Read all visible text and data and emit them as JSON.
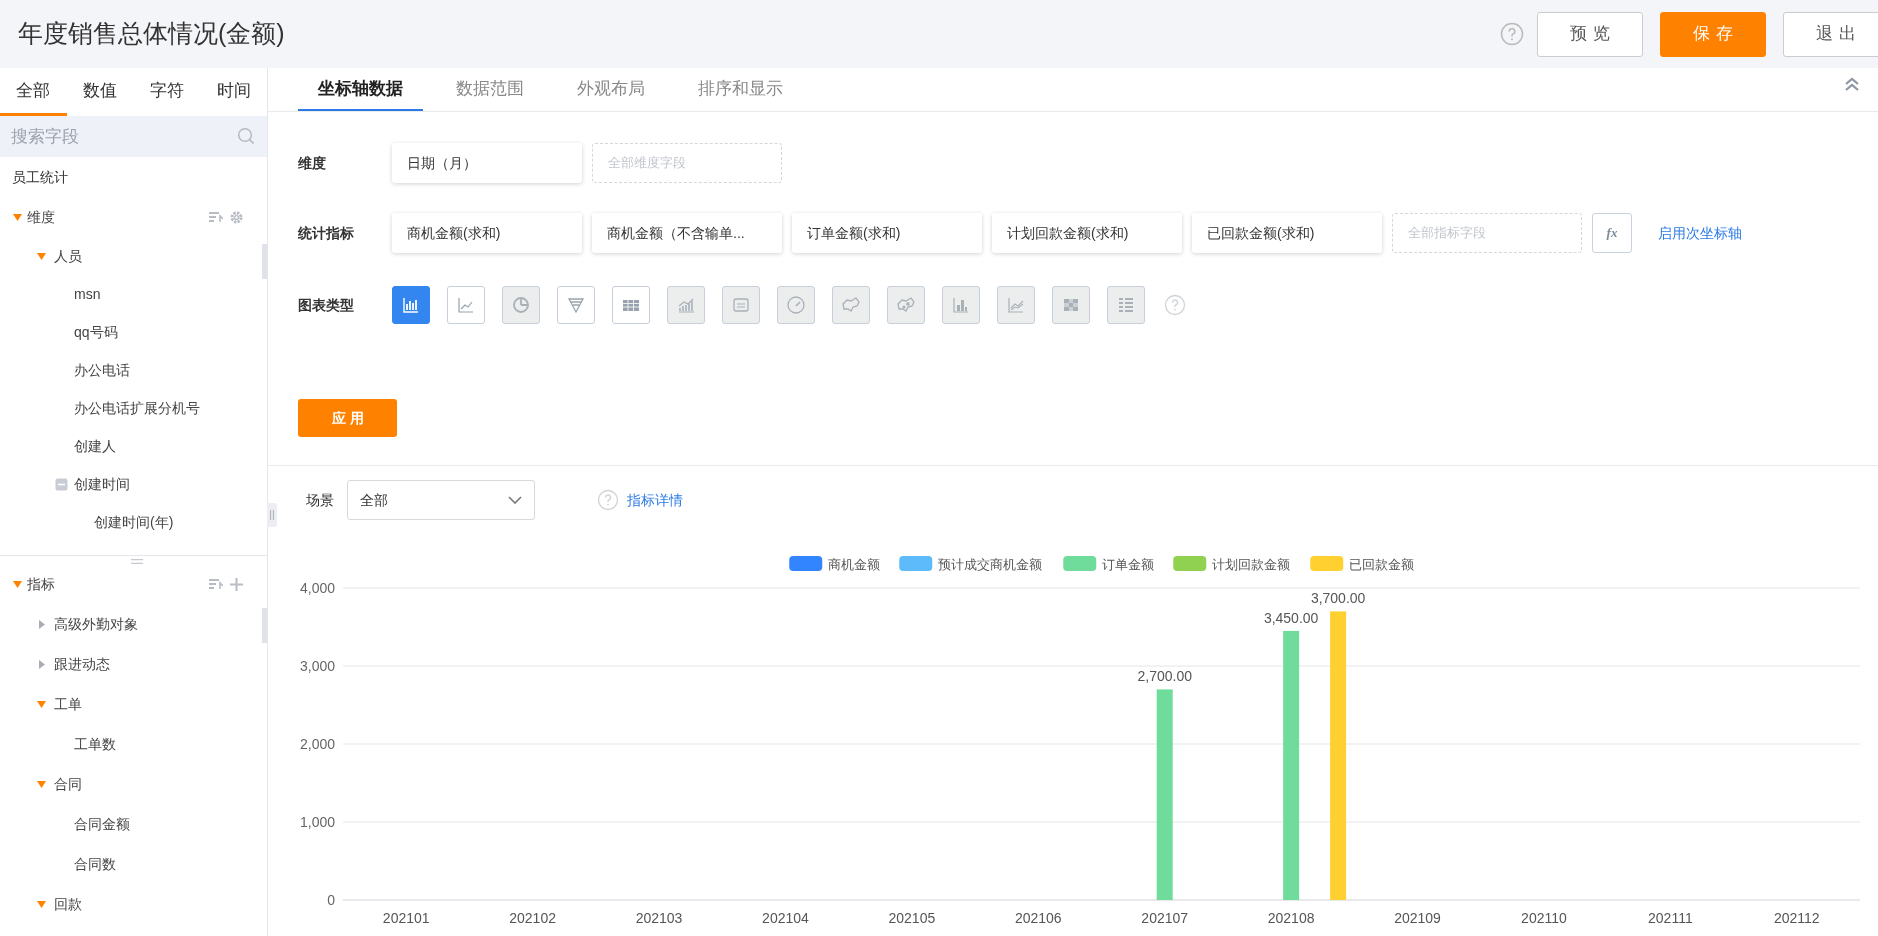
{
  "header": {
    "title": "年度销售总体情况(金额)",
    "buttons": [
      {
        "label": "预览",
        "kind": "default"
      },
      {
        "label": "保存",
        "kind": "primary"
      },
      {
        "label": "退出",
        "kind": "default"
      }
    ]
  },
  "sidebar": {
    "tabs": [
      {
        "label": "全部",
        "selected": true
      },
      {
        "label": "数值",
        "selected": false
      },
      {
        "label": "字符",
        "selected": false
      },
      {
        "label": "时间",
        "selected": false
      }
    ],
    "search": {
      "placeholder": "搜索字段"
    },
    "table_name": "员工统计",
    "sections": [
      {
        "label": "维度",
        "expanded": true,
        "children": [
          {
            "label": "人员",
            "kind": "folder",
            "expanded": true,
            "children": [
              {
                "label": "msn",
                "kind": "field"
              },
              {
                "label": "qq号码",
                "kind": "field"
              },
              {
                "label": "办公电话",
                "kind": "field"
              },
              {
                "label": "办公电话扩展分机号",
                "kind": "field"
              },
              {
                "label": "创建人",
                "kind": "field"
              },
              {
                "label": "创建时间",
                "kind": "time",
                "expanded": true,
                "children": [
                  {
                    "label": "创建时间(年)",
                    "kind": "field"
                  }
                ]
              }
            ]
          }
        ]
      },
      {
        "label": "指标",
        "expanded": true,
        "children": [
          {
            "label": "高级外勤对象",
            "kind": "folder",
            "expanded": false
          },
          {
            "label": "跟进动态",
            "kind": "folder",
            "expanded": false
          },
          {
            "label": "工单",
            "kind": "folder",
            "expanded": true,
            "children": [
              {
                "label": "工单数",
                "kind": "field"
              }
            ]
          },
          {
            "label": "合同",
            "kind": "folder",
            "expanded": true,
            "children": [
              {
                "label": "合同金额",
                "kind": "field"
              },
              {
                "label": "合同数",
                "kind": "field"
              }
            ]
          },
          {
            "label": "回款",
            "kind": "folder",
            "expanded": true
          }
        ]
      }
    ]
  },
  "config": {
    "tabs": [
      {
        "label": "坐标轴数据",
        "selected": true
      },
      {
        "label": "数据范围",
        "selected": false
      },
      {
        "label": "外观布局",
        "selected": false
      },
      {
        "label": "排序和显示",
        "selected": false
      }
    ],
    "dimension": {
      "label": "维度",
      "fields": [
        "日期（月）"
      ],
      "placeholder": "全部维度字段"
    },
    "metrics": {
      "label": "统计指标",
      "fields": [
        "商机金额(求和)",
        "商机金额（不含输单...",
        "订单金额(求和)",
        "计划回款金额(求和)",
        "已回款金额(求和)"
      ],
      "placeholder": "全部指标字段",
      "formula_button": "fx",
      "secondary_axis_link": "启用次坐标轴"
    },
    "chart_types": {
      "label": "图表类型",
      "items": [
        {
          "kind": "bar",
          "selected": true,
          "disabled": false
        },
        {
          "kind": "line",
          "selected": false,
          "disabled": false
        },
        {
          "kind": "pie",
          "selected": false,
          "disabled": true
        },
        {
          "kind": "funnel",
          "selected": false,
          "disabled": false
        },
        {
          "kind": "table",
          "selected": false,
          "disabled": false
        },
        {
          "kind": "combo",
          "selected": false,
          "disabled": true
        },
        {
          "kind": "text",
          "selected": false,
          "disabled": true
        },
        {
          "kind": "gauge",
          "selected": false,
          "disabled": true
        },
        {
          "kind": "map",
          "selected": false,
          "disabled": true
        },
        {
          "kind": "pointmap",
          "selected": false,
          "disabled": true
        },
        {
          "kind": "column",
          "selected": false,
          "disabled": true
        },
        {
          "kind": "multiline",
          "selected": false,
          "disabled": true
        },
        {
          "kind": "heatmap",
          "selected": false,
          "disabled": true
        },
        {
          "kind": "detail",
          "selected": false,
          "disabled": true
        }
      ]
    },
    "apply_button": "应用"
  },
  "preview": {
    "scene": {
      "label": "场景",
      "value": "全部"
    },
    "metric_details_link": "指标详情",
    "chart_data": {
      "type": "bar",
      "categories": [
        "202101",
        "202102",
        "202103",
        "202104",
        "202105",
        "202106",
        "202107",
        "202108",
        "202109",
        "202110",
        "202111",
        "202112"
      ],
      "ylim": [
        0,
        4000
      ],
      "yticks": [
        {
          "value": 0,
          "label": "0"
        },
        {
          "value": 1000,
          "label": "1,000"
        },
        {
          "value": 2000,
          "label": "2,000"
        },
        {
          "value": 3000,
          "label": "3,000"
        },
        {
          "value": 4000,
          "label": "4,000"
        }
      ],
      "grid": true,
      "legend": "top",
      "series": [
        {
          "name": "商机金额",
          "color": "#3385ff",
          "values": [
            null,
            null,
            null,
            null,
            null,
            null,
            null,
            null,
            null,
            null,
            null,
            null
          ]
        },
        {
          "name": "预计成交商机金额",
          "color": "#5dbbfb",
          "values": [
            null,
            null,
            null,
            null,
            null,
            null,
            null,
            null,
            null,
            null,
            null,
            null
          ]
        },
        {
          "name": "订单金额",
          "color": "#70dc9c",
          "values": [
            null,
            null,
            null,
            null,
            null,
            null,
            2700,
            3450,
            null,
            null,
            null,
            null
          ],
          "value_labels": [
            null,
            null,
            null,
            null,
            null,
            null,
            "2,700.00",
            "3,450.00",
            null,
            null,
            null,
            null
          ]
        },
        {
          "name": "计划回款金额",
          "color": "#91d152",
          "values": [
            null,
            null,
            null,
            null,
            null,
            null,
            null,
            null,
            null,
            null,
            null,
            null
          ]
        },
        {
          "name": "已回款金额",
          "color": "#ffd02f",
          "values": [
            null,
            null,
            null,
            null,
            null,
            null,
            null,
            3700,
            null,
            null,
            null,
            null
          ],
          "value_labels": [
            null,
            null,
            null,
            null,
            null,
            null,
            null,
            "3,700.00",
            null,
            null,
            null,
            null
          ]
        }
      ]
    }
  }
}
